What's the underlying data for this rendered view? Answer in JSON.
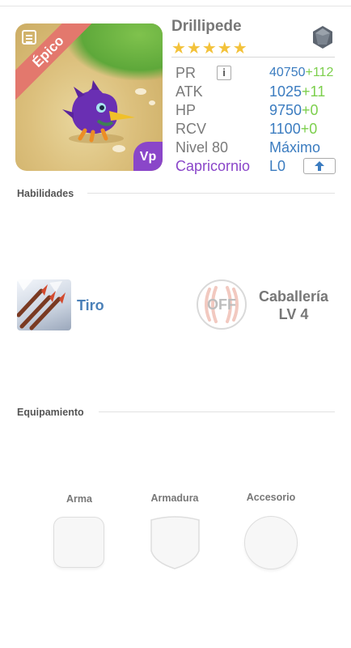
{
  "monster": {
    "name": "Drillipede",
    "rarity": "Épico",
    "stars": "★★★★★",
    "star_count": 5,
    "badge": "Vp"
  },
  "stats": {
    "pr": {
      "label": "PR",
      "value": "40750",
      "bonus": "+112",
      "info": "i"
    },
    "atk": {
      "label": "ATK",
      "value": "1025",
      "bonus": "+11"
    },
    "hp": {
      "label": "HP",
      "value": "9750",
      "bonus": "+0"
    },
    "rcv": {
      "label": "RCV",
      "value": "1100",
      "bonus": "+0"
    },
    "level": {
      "label": "Nivel 80",
      "value": "Máximo"
    },
    "zodiac": {
      "label": "Capricornio",
      "value": "L0"
    }
  },
  "skills": {
    "title": "Habilidades",
    "active": {
      "name": "Tiro"
    },
    "passive": {
      "status": "OFF",
      "name": "Caballería",
      "level": "LV 4"
    }
  },
  "equipment": {
    "title": "Equipamiento",
    "slots": [
      {
        "label": "Arma"
      },
      {
        "label": "Armadura"
      },
      {
        "label": "Accesorio"
      }
    ]
  },
  "colors": {
    "accent_blue": "#3b7cc0",
    "bonus_green": "#7ccf4c",
    "rarity_red": "#e3786d",
    "zodiac_purple": "#8a46c9",
    "star_gold": "#f3c23a"
  },
  "icons": [
    "list-icon",
    "gem-icon",
    "info-icon",
    "upgrade-arrow-icon",
    "arrows-skill-icon",
    "claw-icon"
  ]
}
